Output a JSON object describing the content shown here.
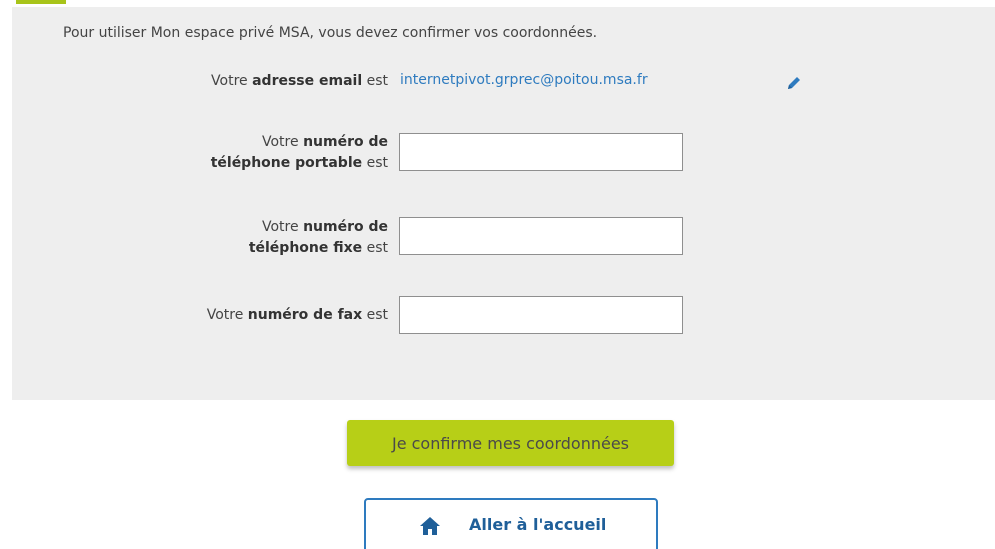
{
  "intro_text": "Pour utiliser Mon espace privé MSA, vous devez confirmer vos coordonnées.",
  "email": {
    "label_prefix": "Votre ",
    "label_bold": "adresse email",
    "label_suffix": " est",
    "value": "internetpivot.grprec@poitou.msa.fr",
    "edit_icon": "pencil-icon"
  },
  "mobile_phone": {
    "label_prefix": "Votre ",
    "label_bold_1": "numéro de",
    "label_bold_2": "téléphone portable",
    "label_suffix": " est",
    "value": ""
  },
  "landline_phone": {
    "label_prefix": "Votre ",
    "label_bold_1": "numéro de",
    "label_bold_2": "téléphone fixe",
    "label_suffix": " est",
    "value": ""
  },
  "fax": {
    "label_prefix": "Votre ",
    "label_bold": "numéro de fax",
    "label_suffix": " est",
    "value": ""
  },
  "confirm_button_label": "Je confirme mes coordonnées",
  "home_button": {
    "label": "Aller à l'accueil",
    "icon": "home-icon"
  },
  "colors": {
    "accent_green": "#b7cf17",
    "link_blue": "#2e7bbf",
    "panel_gray": "#eeeeee"
  }
}
